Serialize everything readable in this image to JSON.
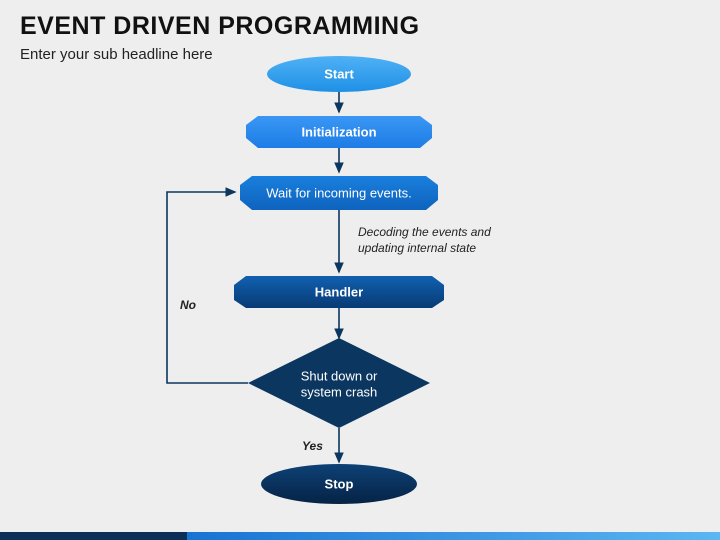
{
  "title": "EVENT DRIVEN PROGRAMMING",
  "subtitle": "Enter your sub headline here",
  "nodes": {
    "start": "Start",
    "init": "Initialization",
    "wait": "Wait for incoming events.",
    "handler": "Handler",
    "decision_l1": "Shut down or",
    "decision_l2": "system crash",
    "stop": "Stop"
  },
  "annotations": {
    "decode_l1": "Decoding the events and",
    "decode_l2": "updating internal state"
  },
  "edge_labels": {
    "no": "No",
    "yes": "Yes"
  },
  "colors": {
    "start_top": "#3aa7f3",
    "start_bot": "#2095ea",
    "init": "#2a8af1",
    "wait_top": "#1579d8",
    "wait_bot": "#0f66c0",
    "handler_top": "#0f5aa9",
    "handler_bot": "#0a3d78",
    "decision": "#0b365f",
    "stop_top": "#0b3c6d",
    "stop_bot": "#082a4c",
    "arrow": "#0b365f"
  },
  "chart_data": {
    "type": "flowchart",
    "title": "Event Driven Programming",
    "nodes": [
      {
        "id": "start",
        "label": "Start",
        "shape": "ellipse"
      },
      {
        "id": "init",
        "label": "Initialization",
        "shape": "cut-rect"
      },
      {
        "id": "wait",
        "label": "Wait for incoming events.",
        "shape": "cut-rect"
      },
      {
        "id": "handler",
        "label": "Handler",
        "shape": "cut-rect"
      },
      {
        "id": "decision",
        "label": "Shut down or system crash",
        "shape": "diamond"
      },
      {
        "id": "stop",
        "label": "Stop",
        "shape": "ellipse"
      }
    ],
    "edges": [
      {
        "from": "start",
        "to": "init"
      },
      {
        "from": "init",
        "to": "wait"
      },
      {
        "from": "wait",
        "to": "handler",
        "annotation": "Decoding the events and updating internal state"
      },
      {
        "from": "handler",
        "to": "decision"
      },
      {
        "from": "decision",
        "to": "stop",
        "label": "Yes"
      },
      {
        "from": "decision",
        "to": "wait",
        "label": "No"
      }
    ]
  }
}
